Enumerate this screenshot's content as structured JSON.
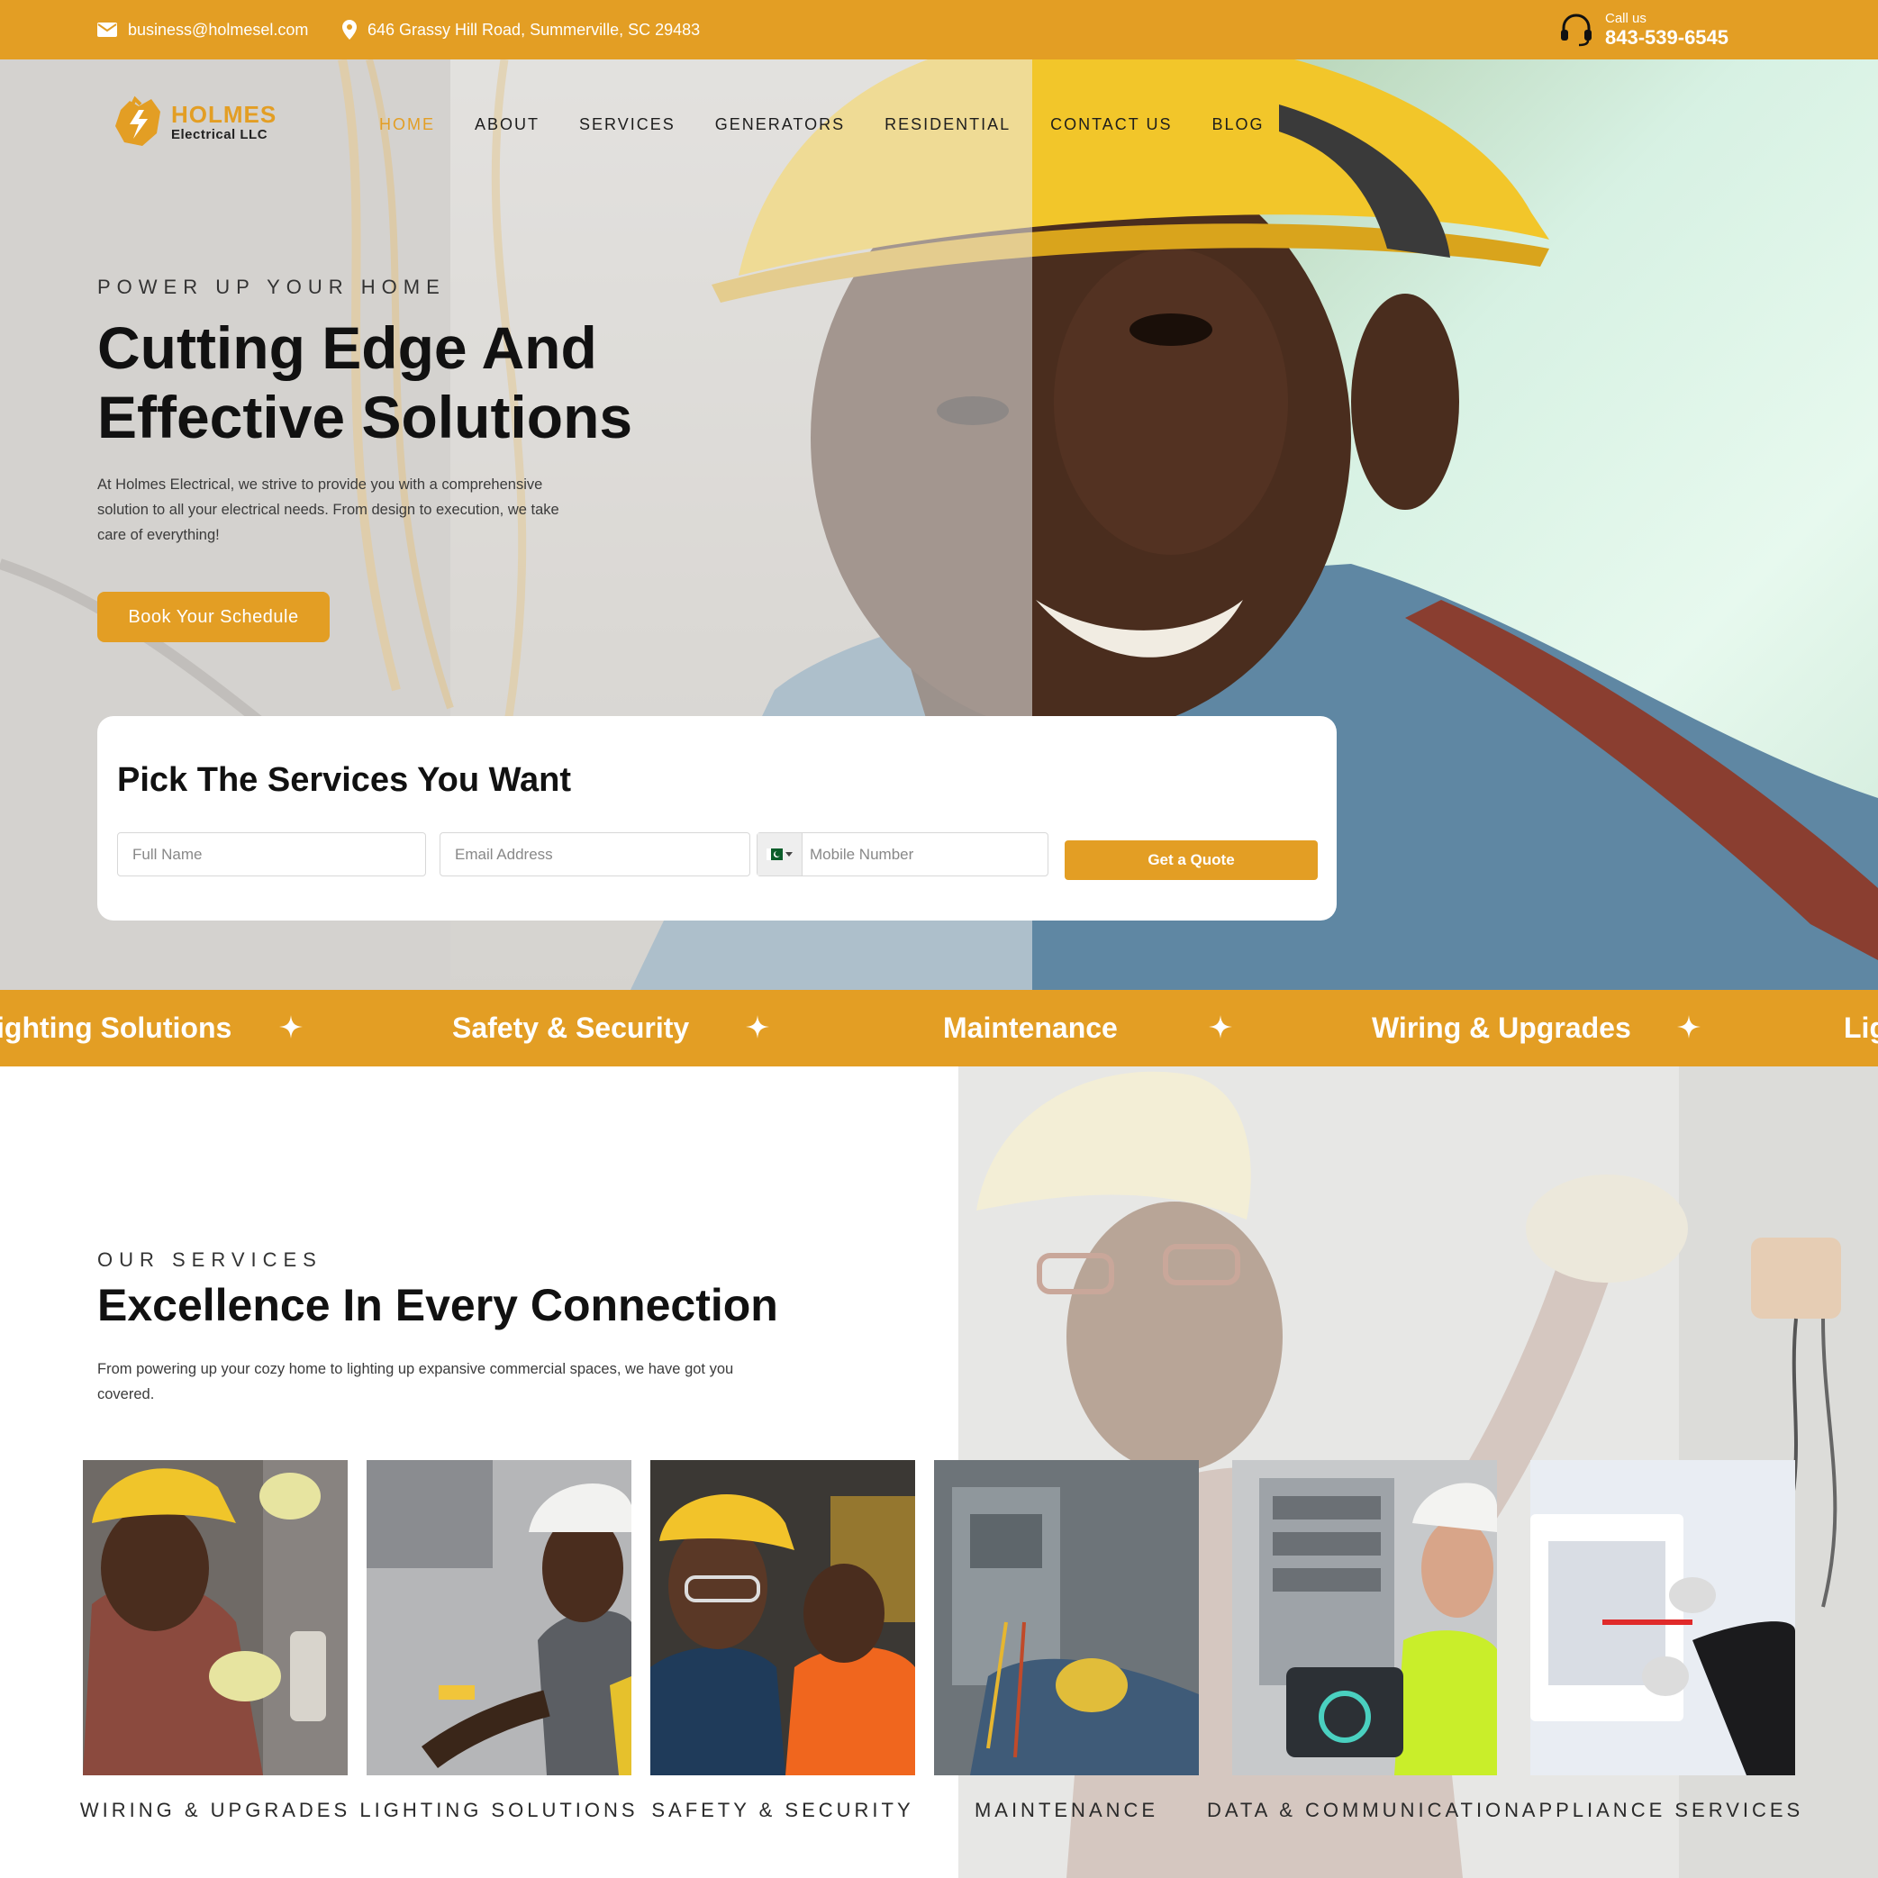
{
  "colors": {
    "accent": "#E39E24",
    "text": "#111111",
    "white": "#ffffff"
  },
  "topbar": {
    "email": "business@holmesel.com",
    "address": "646 Grassy Hill Road, Summerville, SC 29483",
    "call_label": "Call us",
    "call_number": "843-539-6545",
    "icons": [
      "envelope-icon",
      "map-pin-icon",
      "headset-icon"
    ]
  },
  "logo": {
    "name": "HOLMES",
    "subtitle": "Electrical LLC"
  },
  "nav": {
    "items": [
      {
        "label": "HOME",
        "active": true
      },
      {
        "label": "ABOUT",
        "active": false
      },
      {
        "label": "SERVICES",
        "active": false
      },
      {
        "label": "GENERATORS",
        "active": false
      },
      {
        "label": "RESIDENTIAL",
        "active": false
      },
      {
        "label": "CONTACT US",
        "active": false
      },
      {
        "label": "BLOG",
        "active": false
      }
    ]
  },
  "hero": {
    "eyebrow": "POWER UP YOUR HOME",
    "title_line1": "Cutting Edge And",
    "title_line2": "Effective Solutions",
    "description": "At Holmes Electrical, we strive to provide you with a comprehensive solution to all your electrical needs. From design to execution, we take care of everything!",
    "button_label": "Book Your Schedule"
  },
  "quote_form": {
    "title": "Pick The Services You Want",
    "name_placeholder": "Full Name",
    "email_placeholder": "Email Address",
    "phone_placeholder": "Mobile Number",
    "button_label": "Get a Quote"
  },
  "marquee": {
    "items": [
      "ighting Solutions",
      "Safety & Security",
      "Maintenance",
      "Wiring & Upgrades",
      "Lig"
    ]
  },
  "services": {
    "eyebrow": "OUR SERVICES",
    "title": "Excellence In Every Connection",
    "description": "From powering up your cozy home to lighting up expansive commercial spaces, we have got you covered.",
    "cards": [
      {
        "label": "WIRING & UPGRADES"
      },
      {
        "label": "LIGHTING SOLUTIONS"
      },
      {
        "label": "SAFETY & SECURITY"
      },
      {
        "label": "MAINTENANCE"
      },
      {
        "label": "DATA & COMMUNICATION"
      },
      {
        "label": "APPLIANCE SERVICES"
      }
    ]
  }
}
